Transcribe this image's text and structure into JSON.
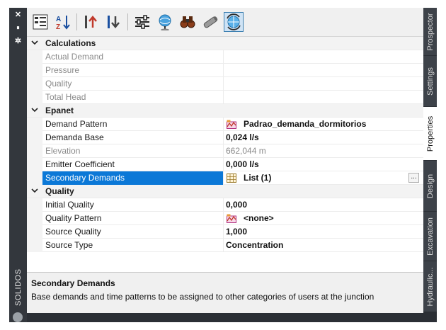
{
  "palette": {
    "title": "SOLIDOS",
    "close_glyph": "✕",
    "pin_glyph": "⏸",
    "settings_glyph": "✲"
  },
  "toolbar": {
    "buttons": [
      {
        "icon": "categorized-icon"
      },
      {
        "icon": "sort-az-icon",
        "text": "AZ"
      },
      {
        "icon": "move-up-icon"
      },
      {
        "icon": "move-down-icon"
      },
      {
        "icon": "filter-settings-icon"
      },
      {
        "icon": "globe-pin-icon"
      },
      {
        "icon": "binoculars-icon"
      },
      {
        "icon": "pipe-icon"
      },
      {
        "icon": "refresh-globe-icon",
        "active": true
      }
    ]
  },
  "grid": {
    "categories": [
      {
        "label": "Calculations",
        "rows": [
          {
            "name": "Actual Demand",
            "value": "",
            "disabled": true
          },
          {
            "name": "Pressure",
            "value": "",
            "disabled": true
          },
          {
            "name": "Quality",
            "value": "",
            "disabled": true
          },
          {
            "name": "Total Head",
            "value": "",
            "disabled": true
          }
        ]
      },
      {
        "label": "Epanet",
        "rows": [
          {
            "name": "Demand Pattern",
            "value": "Padrao_demanda_dormitorios",
            "icon": "pattern-icon"
          },
          {
            "name": "Demanda Base",
            "value": "0,024 l/s"
          },
          {
            "name": "Elevation",
            "value": "662,044 m",
            "disabled": true
          },
          {
            "name": "Emitter Coefficient",
            "value": "0,000 l/s"
          },
          {
            "name": "Secondary Demands",
            "value": "List (1)",
            "icon": "table-icon",
            "selected": true,
            "ellipsis": "..."
          }
        ]
      },
      {
        "label": "Quality",
        "rows": [
          {
            "name": "Initial Quality",
            "value": "0,000"
          },
          {
            "name": "Quality Pattern",
            "value": "<none>",
            "icon": "pattern-icon"
          },
          {
            "name": "Source Quality",
            "value": "1,000"
          },
          {
            "name": "Source Type",
            "value": "Concentration"
          }
        ]
      }
    ]
  },
  "description": {
    "title": "Secondary Demands",
    "text": "Base demands and time patterns to be assigned to other categories of users at the junction"
  },
  "tabs": [
    {
      "label": "Prospector"
    },
    {
      "label": "Settings"
    },
    {
      "label": "Properties",
      "active": true
    },
    {
      "label": "Design"
    },
    {
      "label": "Excavation"
    },
    {
      "label": "Hydraulic..."
    }
  ],
  "colors": {
    "selection": "#0b78d7",
    "frame": "#2b2f35"
  }
}
